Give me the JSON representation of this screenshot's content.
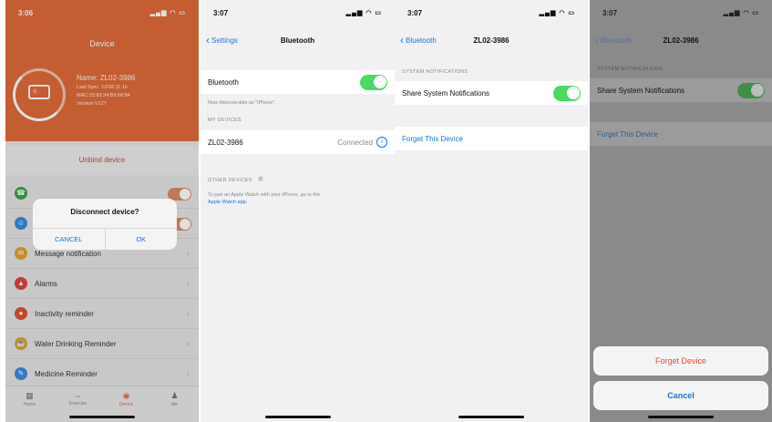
{
  "panel1": {
    "time": "3:06",
    "title": "Device",
    "device_name": "Name: ZL02-3986",
    "last_sync": "Last Sync: 12/18 11:16",
    "mac": "MAC:33:83:34:B9:58:84",
    "version": "Version:V127",
    "battery_label": "Ⓑ",
    "unbind": "Unbind device",
    "menu": [
      {
        "label": "",
        "icon": "☎",
        "color": "#3aa34a",
        "toggle": true
      },
      {
        "label": "",
        "icon": "☺",
        "color": "#3a8ae0",
        "toggle": true
      },
      {
        "label": "Message notification",
        "icon": "✉",
        "color": "#e0a030",
        "toggle": false
      },
      {
        "label": "Alarms",
        "icon": "▲",
        "color": "#e04040",
        "toggle": false
      },
      {
        "label": "Inactivity reminder",
        "icon": "●",
        "color": "#e05030",
        "toggle": false
      },
      {
        "label": "Water Drinking Reminder",
        "icon": "☕",
        "color": "#e0a030",
        "toggle": false
      },
      {
        "label": "Medicine Reminder",
        "icon": "✎",
        "color": "#3a8ae0",
        "toggle": false
      }
    ],
    "alert": {
      "title": "Disconnect device?",
      "cancel": "CANCEL",
      "ok": "OK"
    },
    "tabs": [
      {
        "label": "Home",
        "icon": "▦"
      },
      {
        "label": "Exercise",
        "icon": "⇔"
      },
      {
        "label": "Device",
        "icon": "◉"
      },
      {
        "label": "Me",
        "icon": "♟"
      }
    ]
  },
  "panel2": {
    "time": "3:07",
    "back": "Settings",
    "title": "Bluetooth",
    "bt_label": "Bluetooth",
    "discoverable": "Now discoverable as \"iPhone\".",
    "my_devices": "MY DEVICES",
    "device": "ZL02-3986",
    "device_status": "Connected",
    "other_devices": "OTHER DEVICES",
    "pair_note": "To pair an Apple Watch with your iPhone, go to the",
    "pair_link": "Apple Watch app."
  },
  "panel3": {
    "time": "3:07",
    "back": "Bluetooth",
    "title": "ZL02-3986",
    "section": "SYSTEM NOTIFICATIONS",
    "share": "Share System Notifications",
    "forget": "Forget This Device"
  },
  "panel4": {
    "time": "3:07",
    "back": "Bluetooth",
    "title": "ZL02-3986",
    "section": "SYSTEM NOTIFICATIONS",
    "share": "Share System Notifications",
    "forget": "Forget This Device",
    "sheet_forget": "Forget Device",
    "sheet_cancel": "Cancel"
  },
  "status_icons": "▂▄▆ ◠ ▭"
}
